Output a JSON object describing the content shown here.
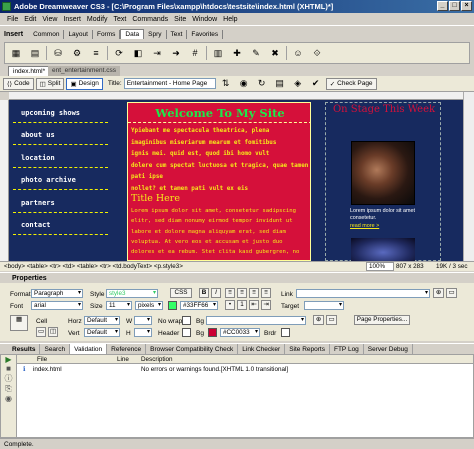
{
  "window": {
    "title": "Adobe Dreamweaver CS3 - [C:\\Program Files\\xampp\\htdocs\\testsite\\index.html (XHTML)*]"
  },
  "menu": [
    "File",
    "Edit",
    "View",
    "Insert",
    "Modify",
    "Text",
    "Commands",
    "Site",
    "Window",
    "Help"
  ],
  "insert": {
    "title": "Insert",
    "tabs": [
      "Common",
      "Layout",
      "Forms",
      "Data",
      "Spry",
      "Text",
      "Favorites"
    ],
    "active_tab": "Data"
  },
  "doc_tabs": [
    "index.html*",
    "ent_entertainment.css"
  ],
  "doc_toolbar": {
    "code": "Code",
    "split": "Split",
    "design": "Design",
    "title_label": "Title:",
    "title_value": "Entertainment - Home Page",
    "check_page": "Check Page"
  },
  "page": {
    "nav": [
      "upcoming shows",
      "about us",
      "location",
      "photo archive",
      "partners",
      "contact"
    ],
    "welcome": "Welcome To My Site",
    "yellow_lines": [
      "Ypiebant me spectacula theatrica, plena",
      "imaginibus miseriarum mearum et fomitibus",
      "ignis mei. quid est, quod ibi homo vult",
      "dolere cum spectat luctuosa et tragica, quae tamen pati ipse",
      "nollet? et tamen pati vult ex eis"
    ],
    "title_here": "Title Here",
    "lorem_lines": [
      "Lorem ipsum dolor sit amet, consetetur sadipscing",
      "elitr, sed diam nonumy eirmod tempor invidunt ut",
      "labore et dolore magna aliquyam erat, sed diam",
      "voluptua. At vero eos et accusam et justo duo",
      "dolores et ea rebum. Stet clita kasd gubergren, no"
    ],
    "onstage": "On Stage This Week",
    "right_text": "Lorem ipsum dolor sit amet consetetur.",
    "read_more": "read more >"
  },
  "status": {
    "tags": "<body> <table> <tr> <td> <table> <tr> <td.bodyText> <p.style3>",
    "zoom": "100%",
    "dims": "807 x 283",
    "size": "19K / 3 sec"
  },
  "properties": {
    "title": "Properties",
    "format_label": "Format",
    "format_value": "Paragraph",
    "style_label": "Style",
    "style_value": "style3",
    "css_btn": "CSS",
    "bold": "B",
    "italic": "I",
    "link_label": "Link",
    "font_label": "Font",
    "font_value": "arial",
    "size_label": "Size",
    "size_value": "11",
    "size_unit": "pixels",
    "color_value": "#33FF66",
    "color_swatch": "#33ff66",
    "target_label": "Target",
    "cell_label": "Cell",
    "horz_label": "Horz",
    "horz_value": "Default",
    "vert_label": "Vert",
    "vert_value": "Default",
    "w_label": "W",
    "h_label": "H",
    "nowrap_label": "No wrap",
    "header_label": "Header",
    "bg_label": "Bg",
    "bg2_label": "Bg",
    "bg_color_value": "#CC0033",
    "bg_swatch": "#cc0033",
    "brdr_label": "Brdr",
    "page_props_btn": "Page Properties..."
  },
  "results": {
    "title": "Results",
    "tabs": [
      "Search",
      "Validation",
      "Reference",
      "Browser Compatibility Check",
      "Link Checker",
      "Site Reports",
      "FTP Log",
      "Server Debug"
    ],
    "active_tab": "Validation",
    "col_file": "File",
    "col_line": "Line",
    "col_desc": "Description",
    "row_file": "index.html",
    "row_desc": "No errors or warnings found.[XHTML 1.0 transitional]"
  },
  "footer": {
    "status": "Complete."
  }
}
